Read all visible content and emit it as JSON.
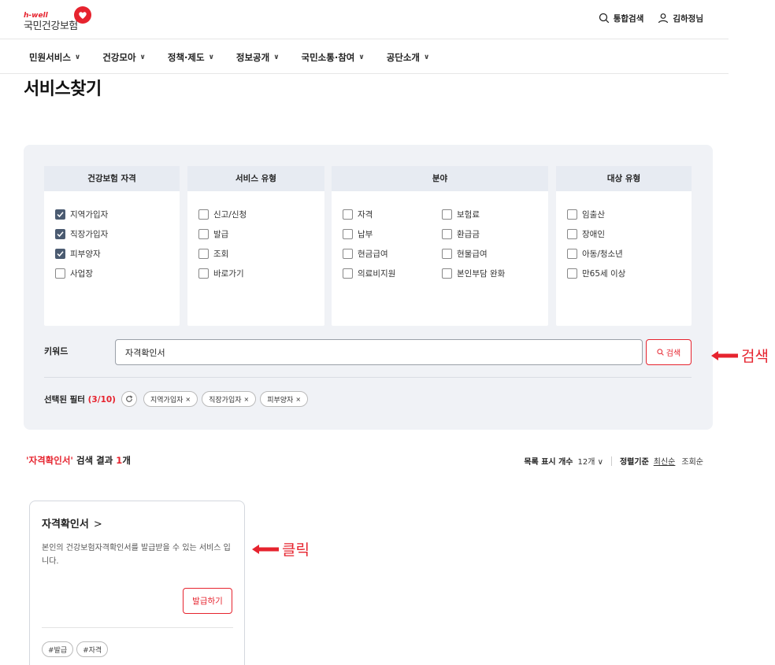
{
  "header": {
    "logo_small": "h-well",
    "logo_main": "국민건강보험",
    "search_label": "통합검색",
    "user_label": "김하정님"
  },
  "gnb": {
    "items": [
      {
        "label": "민원서비스"
      },
      {
        "label": "건강모아"
      },
      {
        "label": "정책·제도"
      },
      {
        "label": "정보공개"
      },
      {
        "label": "국민소통·참여"
      },
      {
        "label": "공단소개"
      }
    ]
  },
  "page": {
    "title": "서비스찾기"
  },
  "filters": {
    "qualification": {
      "title": "건강보험 자격",
      "options": [
        {
          "label": "지역가입자",
          "checked": true
        },
        {
          "label": "직장가입자",
          "checked": true
        },
        {
          "label": "피부양자",
          "checked": true
        },
        {
          "label": "사업장",
          "checked": false
        }
      ]
    },
    "service_type": {
      "title": "서비스 유형",
      "options": [
        {
          "label": "신고/신청",
          "checked": false
        },
        {
          "label": "발급",
          "checked": false
        },
        {
          "label": "조회",
          "checked": false
        },
        {
          "label": "바로가기",
          "checked": false
        }
      ]
    },
    "field": {
      "title": "분야",
      "options": [
        {
          "label": "자격",
          "checked": false
        },
        {
          "label": "보험료",
          "checked": false
        },
        {
          "label": "납부",
          "checked": false
        },
        {
          "label": "환급금",
          "checked": false
        },
        {
          "label": "현금급여",
          "checked": false
        },
        {
          "label": "현물급여",
          "checked": false
        },
        {
          "label": "의료비지원",
          "checked": false
        },
        {
          "label": "본인부담 완화",
          "checked": false
        }
      ]
    },
    "target": {
      "title": "대상 유형",
      "options": [
        {
          "label": "임출산",
          "checked": false
        },
        {
          "label": "장애인",
          "checked": false
        },
        {
          "label": "아동/청소년",
          "checked": false
        },
        {
          "label": "만65세 이상",
          "checked": false
        }
      ]
    }
  },
  "keyword": {
    "label": "키워드",
    "value": "자격확인서",
    "search_button": "검색"
  },
  "selected": {
    "label": "선택된 필터",
    "count_text": "(3/10)",
    "chips": [
      "지역가입자",
      "직장가입자",
      "피부양자"
    ],
    "chip_close": "×"
  },
  "results": {
    "keyword_quoted": "'자격확인서'",
    "middle": " 검색 결과 ",
    "count": "1",
    "suffix": "개",
    "list_count_label": "목록 표시 개수",
    "list_count_value": "12개",
    "sort_label": "정렬기준",
    "sort_options": [
      "최신순",
      "조회순"
    ]
  },
  "card": {
    "title": "자격확인서",
    "arrow": ">",
    "description": "본인의 건강보험자격확인서를 발급받을 수 있는 서비스 입니다.",
    "action": "발급하기",
    "tags": [
      "#발급",
      "#자격"
    ]
  },
  "annotations": {
    "search": "검색",
    "click": "클릭"
  },
  "colors": {
    "accent": "#e6232e",
    "filter_bg": "#f0f2f6",
    "checkbox_checked": "#4b5b71"
  }
}
